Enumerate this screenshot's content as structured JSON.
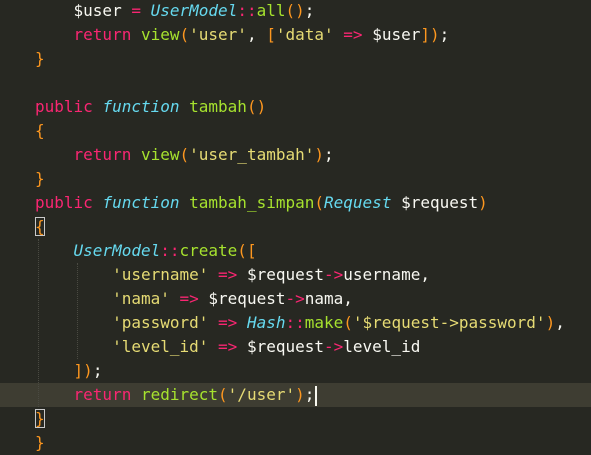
{
  "editor": {
    "lines": [
      {
        "segments": [
          {
            "t": "    ",
            "c": "p"
          },
          {
            "t": "$user",
            "c": "v"
          },
          {
            "t": " ",
            "c": "p"
          },
          {
            "t": "=",
            "c": "op"
          },
          {
            "t": " ",
            "c": "p"
          },
          {
            "t": "UserModel",
            "c": "ty"
          },
          {
            "t": "::",
            "c": "op"
          },
          {
            "t": "all",
            "c": "fn"
          },
          {
            "t": "()",
            "c": "br"
          },
          {
            "t": ";",
            "c": "p"
          }
        ]
      },
      {
        "segments": [
          {
            "t": "    ",
            "c": "p"
          },
          {
            "t": "return",
            "c": "k"
          },
          {
            "t": " ",
            "c": "p"
          },
          {
            "t": "view",
            "c": "fn"
          },
          {
            "t": "(",
            "c": "br"
          },
          {
            "t": "'user'",
            "c": "st"
          },
          {
            "t": ", ",
            "c": "p"
          },
          {
            "t": "[",
            "c": "br"
          },
          {
            "t": "'data'",
            "c": "st"
          },
          {
            "t": " ",
            "c": "p"
          },
          {
            "t": "=>",
            "c": "op"
          },
          {
            "t": " ",
            "c": "p"
          },
          {
            "t": "$user",
            "c": "v"
          },
          {
            "t": "]",
            "c": "br"
          },
          {
            "t": ")",
            "c": "br"
          },
          {
            "t": ";",
            "c": "p"
          }
        ]
      },
      {
        "segments": [
          {
            "t": "}",
            "c": "br"
          }
        ]
      },
      {
        "segments": []
      },
      {
        "segments": [
          {
            "t": "public",
            "c": "k"
          },
          {
            "t": " ",
            "c": "p"
          },
          {
            "t": "function",
            "c": "sf"
          },
          {
            "t": " ",
            "c": "p"
          },
          {
            "t": "tambah",
            "c": "fn"
          },
          {
            "t": "()",
            "c": "br"
          }
        ]
      },
      {
        "segments": [
          {
            "t": "{",
            "c": "br"
          }
        ]
      },
      {
        "segments": [
          {
            "t": "    ",
            "c": "p"
          },
          {
            "t": "return",
            "c": "k"
          },
          {
            "t": " ",
            "c": "p"
          },
          {
            "t": "view",
            "c": "fn"
          },
          {
            "t": "(",
            "c": "br"
          },
          {
            "t": "'user_tambah'",
            "c": "st"
          },
          {
            "t": ")",
            "c": "br"
          },
          {
            "t": ";",
            "c": "p"
          }
        ]
      },
      {
        "segments": [
          {
            "t": "}",
            "c": "br"
          }
        ]
      },
      {
        "segments": [
          {
            "t": "public",
            "c": "k"
          },
          {
            "t": " ",
            "c": "p"
          },
          {
            "t": "function",
            "c": "sf"
          },
          {
            "t": " ",
            "c": "p"
          },
          {
            "t": "tambah_simpan",
            "c": "fn"
          },
          {
            "t": "(",
            "c": "br"
          },
          {
            "t": "Request",
            "c": "ty"
          },
          {
            "t": " ",
            "c": "p"
          },
          {
            "t": "$request",
            "c": "v"
          },
          {
            "t": ")",
            "c": "br"
          }
        ]
      },
      {
        "segments": [
          {
            "t": "{",
            "c": "br",
            "hl": true
          }
        ]
      },
      {
        "segments": [
          {
            "t": "    ",
            "c": "p"
          },
          {
            "t": "UserModel",
            "c": "ty"
          },
          {
            "t": "::",
            "c": "op"
          },
          {
            "t": "create",
            "c": "fn"
          },
          {
            "t": "(",
            "c": "br"
          },
          {
            "t": "[",
            "c": "br"
          }
        ]
      },
      {
        "segments": [
          {
            "t": "        ",
            "c": "p"
          },
          {
            "t": "'username'",
            "c": "st"
          },
          {
            "t": " ",
            "c": "p"
          },
          {
            "t": "=>",
            "c": "op"
          },
          {
            "t": " ",
            "c": "p"
          },
          {
            "t": "$request",
            "c": "v"
          },
          {
            "t": "->",
            "c": "op"
          },
          {
            "t": "username",
            "c": "v"
          },
          {
            "t": ",",
            "c": "p"
          }
        ]
      },
      {
        "segments": [
          {
            "t": "        ",
            "c": "p"
          },
          {
            "t": "'nama'",
            "c": "st"
          },
          {
            "t": " ",
            "c": "p"
          },
          {
            "t": "=>",
            "c": "op"
          },
          {
            "t": " ",
            "c": "p"
          },
          {
            "t": "$request",
            "c": "v"
          },
          {
            "t": "->",
            "c": "op"
          },
          {
            "t": "nama",
            "c": "v"
          },
          {
            "t": ",",
            "c": "p"
          }
        ]
      },
      {
        "segments": [
          {
            "t": "        ",
            "c": "p"
          },
          {
            "t": "'password'",
            "c": "st"
          },
          {
            "t": " ",
            "c": "p"
          },
          {
            "t": "=>",
            "c": "op"
          },
          {
            "t": " ",
            "c": "p"
          },
          {
            "t": "Hash",
            "c": "ty"
          },
          {
            "t": "::",
            "c": "op"
          },
          {
            "t": "make",
            "c": "fn"
          },
          {
            "t": "(",
            "c": "br"
          },
          {
            "t": "'$request->password'",
            "c": "st"
          },
          {
            "t": ")",
            "c": "br"
          },
          {
            "t": ",",
            "c": "p"
          }
        ]
      },
      {
        "segments": [
          {
            "t": "        ",
            "c": "p"
          },
          {
            "t": "'level_id'",
            "c": "st"
          },
          {
            "t": " ",
            "c": "p"
          },
          {
            "t": "=>",
            "c": "op"
          },
          {
            "t": " ",
            "c": "p"
          },
          {
            "t": "$request",
            "c": "v"
          },
          {
            "t": "->",
            "c": "op"
          },
          {
            "t": "level_id",
            "c": "v"
          }
        ]
      },
      {
        "segments": [
          {
            "t": "    ",
            "c": "p"
          },
          {
            "t": "]",
            "c": "br"
          },
          {
            "t": ")",
            "c": "br"
          },
          {
            "t": ";",
            "c": "p"
          }
        ]
      },
      {
        "segments": [
          {
            "t": "    ",
            "c": "p"
          },
          {
            "t": "return",
            "c": "k"
          },
          {
            "t": " ",
            "c": "p"
          },
          {
            "t": "redirect",
            "c": "fn"
          },
          {
            "t": "(",
            "c": "br"
          },
          {
            "t": "'/user'",
            "c": "st"
          },
          {
            "t": ")",
            "c": "br"
          },
          {
            "t": ";",
            "c": "p"
          }
        ],
        "active": true,
        "caret": true
      },
      {
        "segments": [
          {
            "t": "}",
            "c": "br",
            "hl": true
          }
        ]
      },
      {
        "segments": [
          {
            "t": "}",
            "c": "br"
          }
        ]
      }
    ]
  },
  "colors": {
    "background": "#272822",
    "active_line": "#3e3d32",
    "keyword": "#f92672",
    "function_name": "#a6e22e",
    "string": "#e6db74",
    "type_italic": "#66d9ef",
    "bracket": "#fd971f",
    "text": "#f8f8f2"
  }
}
